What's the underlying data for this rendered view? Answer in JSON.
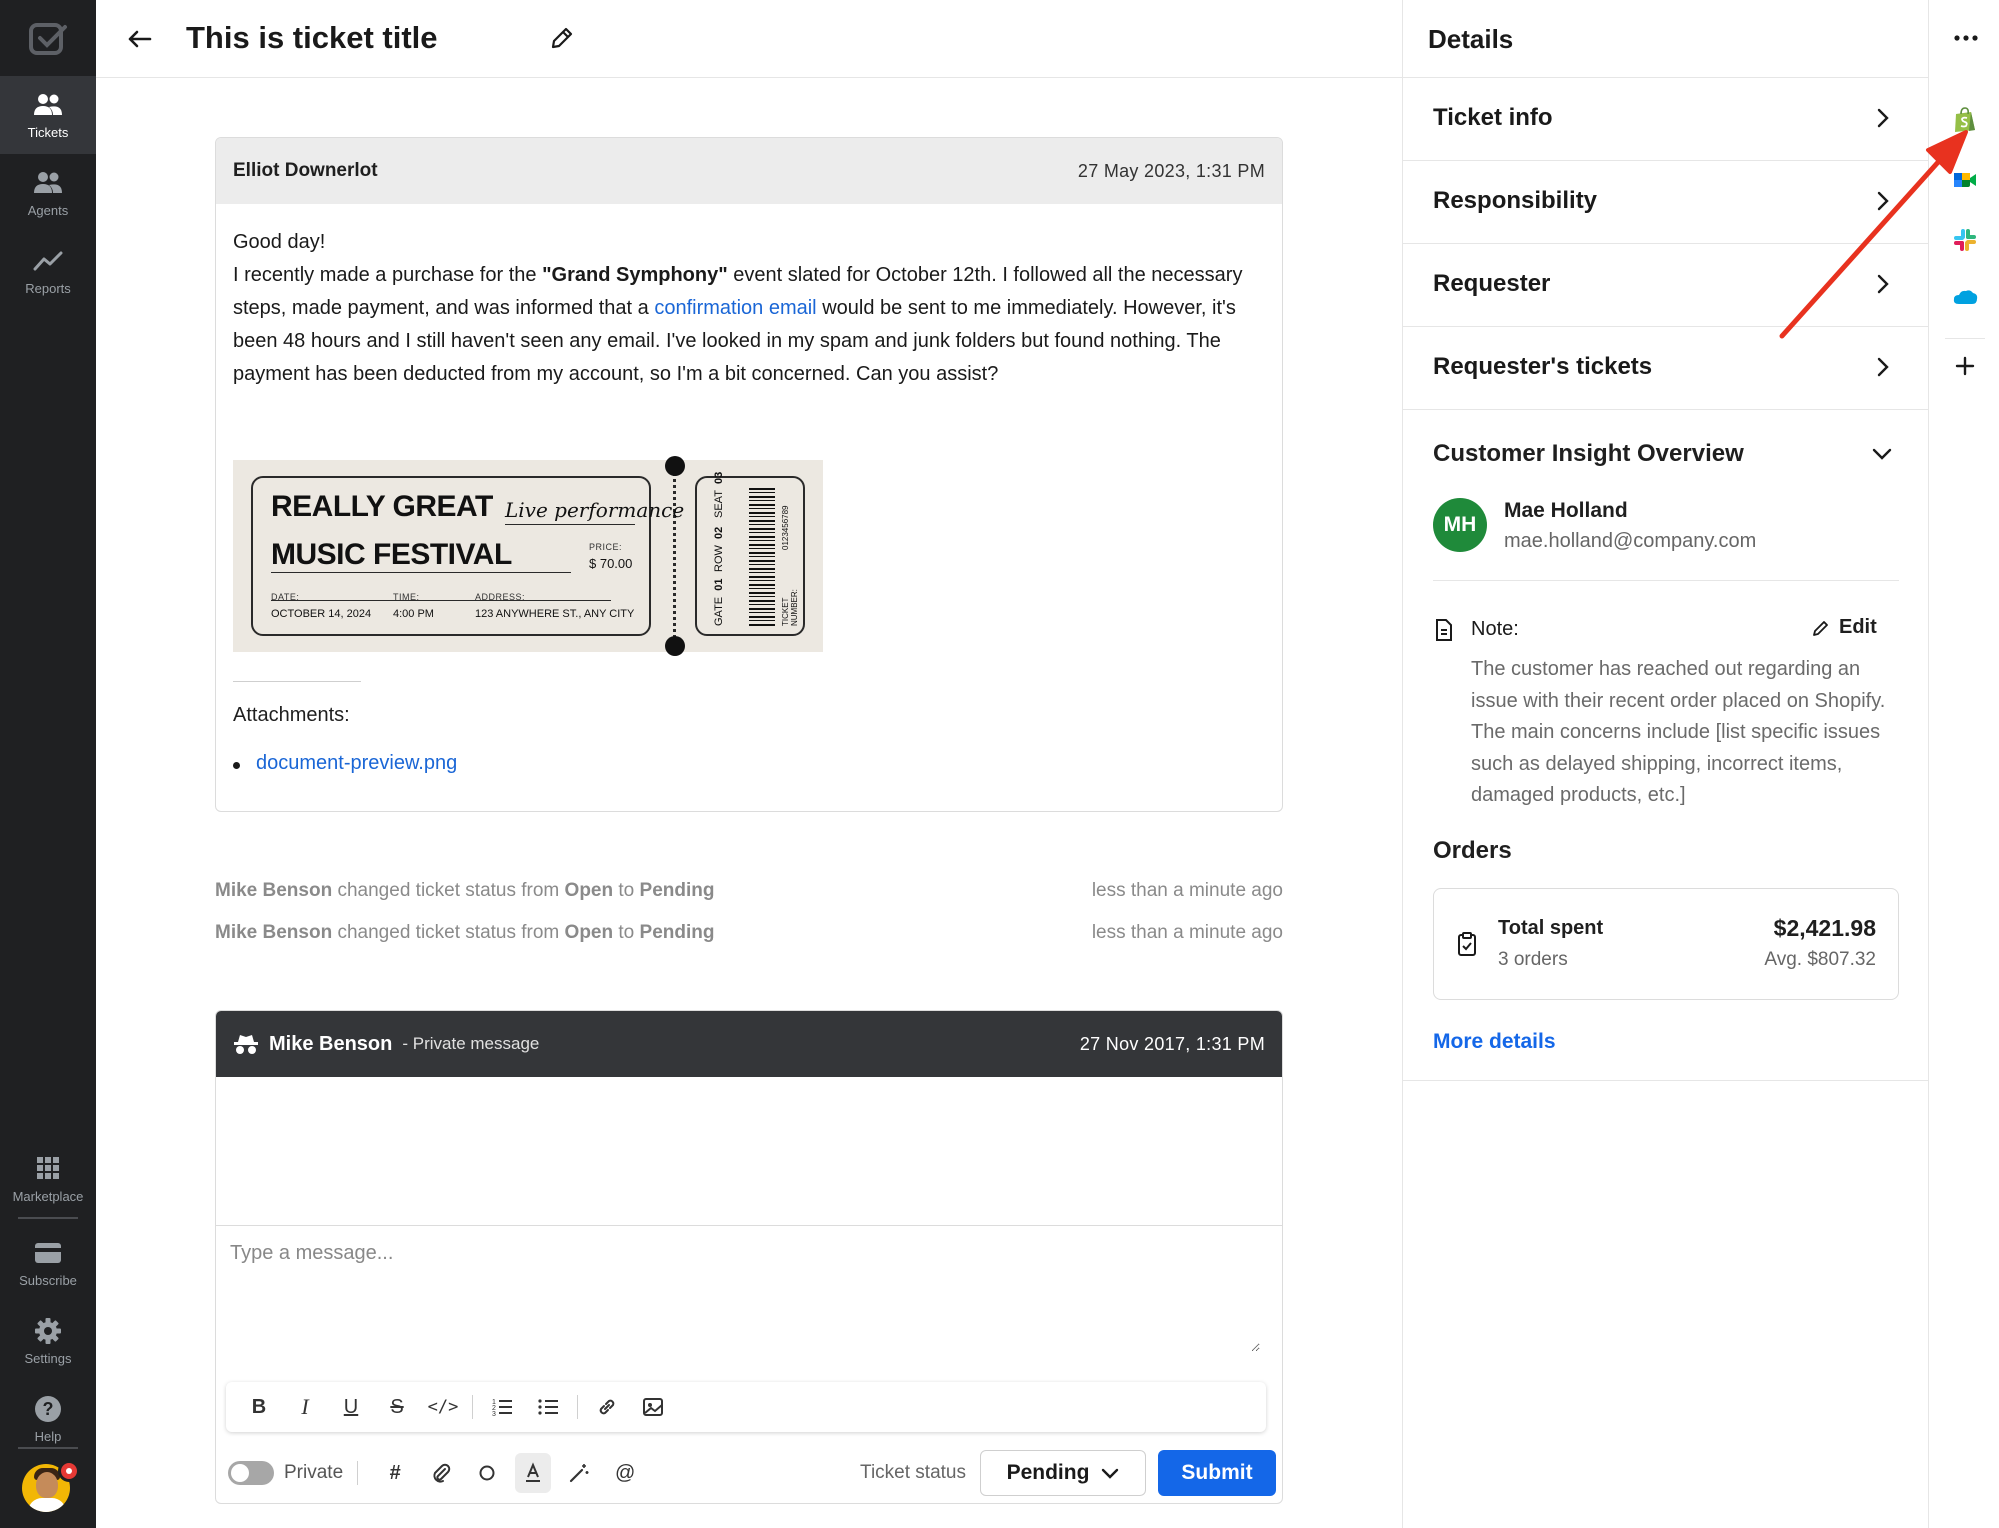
{
  "nav": {
    "items": [
      {
        "label": "Tickets",
        "icon": "people-icon"
      },
      {
        "label": "Agents",
        "icon": "people-icon"
      },
      {
        "label": "Reports",
        "icon": "trend-icon"
      }
    ],
    "bottom_items": [
      {
        "label": "Marketplace",
        "icon": "grid-icon"
      },
      {
        "label": "Subscribe",
        "icon": "card-icon"
      },
      {
        "label": "Settings",
        "icon": "gear-icon"
      },
      {
        "label": "Help",
        "icon": "help-icon"
      }
    ]
  },
  "header": {
    "title": "This is ticket title"
  },
  "message": {
    "author": "Elliot Downerlot",
    "date": "27 May 2023, 1:31 PM",
    "greeting": "Good day!",
    "body_part1": "I recently made a purchase for the ",
    "body_bold": "\"Grand Symphony\"",
    "body_part2": " event slated for October 12th. I followed all the necessary steps, made payment, and was informed that a ",
    "body_link": "confirmation email",
    "body_part3": " would be sent to me immediately. However, it's been 48 hours and I still haven't seen any email. I've looked in my spam and junk folders but found nothing. The payment has been deducted from my account, so I'm a bit concerned. Can you assist?",
    "ticket_image": {
      "line1": "REALLY GREAT",
      "line2": "MUSIC FESTIVAL",
      "script": "Live performance",
      "price_label": "PRICE:",
      "price": "$ 70.00",
      "date_label": "DATE:",
      "date": "OCTOBER 14, 2024",
      "time_label": "TIME:",
      "time": "4:00 PM",
      "address_label": "ADDRESS:",
      "address": "123 ANYWHERE ST., ANY CITY",
      "seat_label": "SEAT",
      "seat": "03",
      "row_label": "ROW",
      "row": "02",
      "gate_label": "GATE",
      "gate": "01",
      "ticket_number_label": "TICKET NUMBER:",
      "ticket_number": "0123456789"
    },
    "attachments_label": "Attachments:",
    "attachments": [
      "document-preview.png"
    ]
  },
  "activity": [
    {
      "actor": "Mike Benson",
      "text1": " changed ticket status from ",
      "from": "Open",
      "text2": " to ",
      "to": "Pending",
      "time": "less than a minute ago"
    },
    {
      "actor": "Mike Benson",
      "text1": " changed ticket status from ",
      "from": "Open",
      "text2": " to ",
      "to": "Pending",
      "time": "less than a minute ago"
    }
  ],
  "private_message": {
    "author": "Mike Benson",
    "kind": "- Private message",
    "date": "27 Nov 2017, 1:31 PM"
  },
  "composer": {
    "placeholder": "Type a message...",
    "private_label": "Private",
    "status_label": "Ticket status",
    "status_value": "Pending",
    "submit_label": "Submit"
  },
  "details": {
    "title": "Details",
    "sections": [
      "Ticket info",
      "Responsibility",
      "Requester",
      "Requester's tickets"
    ],
    "insight_title": "Customer Insight Overview",
    "customer": {
      "initials": "MH",
      "name": "Mae Holland",
      "email": "mae.holland@company.com"
    },
    "note_label": "Note:",
    "note_edit": "Edit",
    "note_text": "The customer has reached out regarding an issue with their recent order placed on Shopify. The main concerns include [list specific issues such as delayed shipping, incorrect items, damaged products, etc.]",
    "orders_title": "Orders",
    "orders": {
      "total_label": "Total spent",
      "count": "3 orders",
      "total_value": "$2,421.98",
      "average": "Avg. $807.32"
    },
    "more_details": "More details"
  },
  "apps": [
    "shopify-icon",
    "google-meet-icon",
    "slack-icon",
    "salesforce-icon"
  ],
  "colors": {
    "nav_bg": "#1f2022",
    "accent": "#1467e8",
    "link": "#1a66d6",
    "avatar_green": "#1f8a3a",
    "annotation_red": "#e8321f"
  }
}
